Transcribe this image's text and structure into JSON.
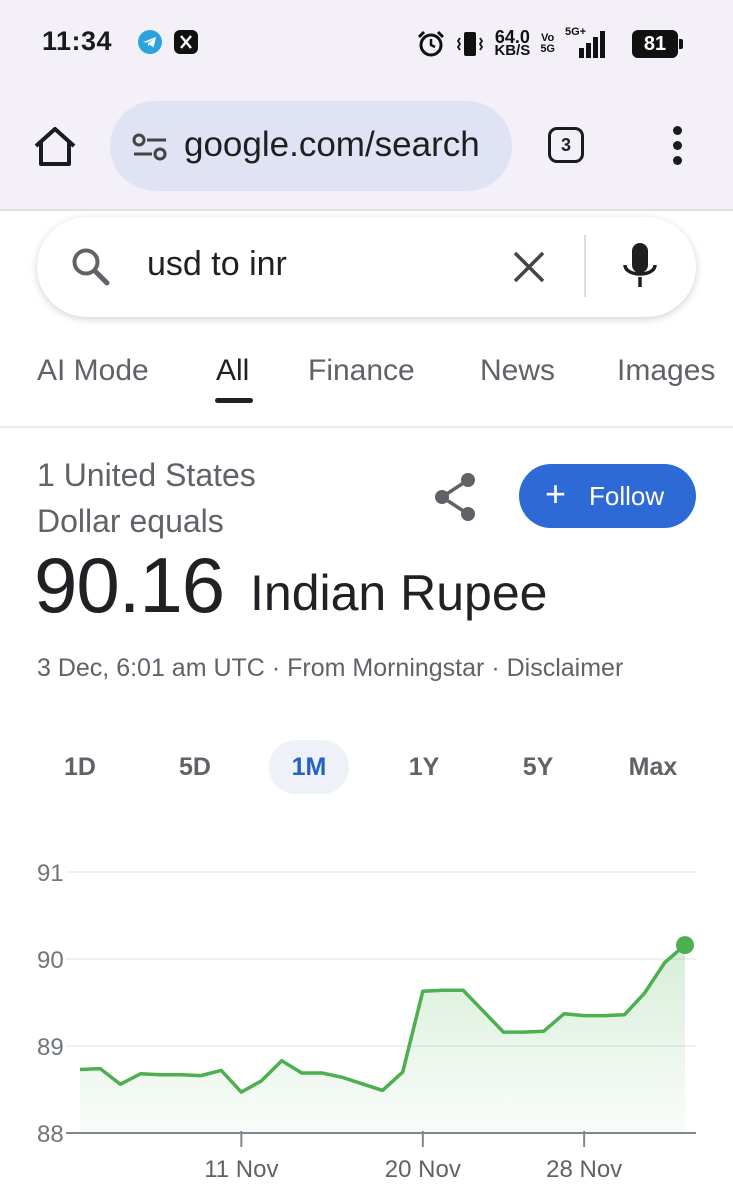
{
  "status_bar": {
    "time": "11:34",
    "notification_icons": [
      "telegram-icon",
      "x-icon"
    ],
    "network_speed_value": "64.0",
    "network_speed_unit": "KB/S",
    "volte_top": "Vo",
    "volte_bottom": "5G",
    "signal_label": "5G+",
    "battery": "81"
  },
  "browser": {
    "url": "google.com/search",
    "tab_count": "3"
  },
  "search": {
    "query": "usd to inr"
  },
  "tabs": [
    {
      "label": "AI Mode",
      "active": false
    },
    {
      "label": "All",
      "active": true
    },
    {
      "label": "Finance",
      "active": false
    },
    {
      "label": "News",
      "active": false
    },
    {
      "label": "Images",
      "active": false
    }
  ],
  "converter": {
    "equals_label": "1 United States Dollar equals",
    "rate": "90.16",
    "currency": "Indian Rupee",
    "timestamp": "3 Dec, 6:01 am UTC",
    "separator": "·",
    "source": "From Morningstar",
    "disclaimer": "Disclaimer",
    "follow_label": "Follow"
  },
  "ranges": [
    {
      "label": "1D",
      "active": false
    },
    {
      "label": "5D",
      "active": false
    },
    {
      "label": "1M",
      "active": true
    },
    {
      "label": "1Y",
      "active": false
    },
    {
      "label": "5Y",
      "active": false
    },
    {
      "label": "Max",
      "active": false
    }
  ],
  "colors": {
    "line": "#4caf50",
    "accent": "#2e6ad6"
  },
  "chart_data": {
    "type": "line",
    "title": "",
    "xlabel": "",
    "ylabel": "",
    "ylim": [
      88,
      91
    ],
    "yticks": [
      88,
      89,
      90,
      91
    ],
    "xlim": [
      "2025-11-03",
      "2025-12-03"
    ],
    "xticks": [
      {
        "date": "2025-11-11",
        "label": "11 Nov"
      },
      {
        "date": "2025-11-20",
        "label": "20 Nov"
      },
      {
        "date": "2025-11-28",
        "label": "28 Nov"
      }
    ],
    "grid": true,
    "series": [
      {
        "values": [
          {
            "x": "2025-11-03",
            "y": 88.73
          },
          {
            "x": "2025-11-04",
            "y": 88.74
          },
          {
            "x": "2025-11-05",
            "y": 88.56
          },
          {
            "x": "2025-11-06",
            "y": 88.68
          },
          {
            "x": "2025-11-07",
            "y": 88.67
          },
          {
            "x": "2025-11-08",
            "y": 88.67
          },
          {
            "x": "2025-11-09",
            "y": 88.66
          },
          {
            "x": "2025-11-10",
            "y": 88.72
          },
          {
            "x": "2025-11-11",
            "y": 88.47
          },
          {
            "x": "2025-11-12",
            "y": 88.6
          },
          {
            "x": "2025-11-13",
            "y": 88.83
          },
          {
            "x": "2025-11-14",
            "y": 88.69
          },
          {
            "x": "2025-11-15",
            "y": 88.69
          },
          {
            "x": "2025-11-16",
            "y": 88.64
          },
          {
            "x": "2025-11-18",
            "y": 88.49
          },
          {
            "x": "2025-11-19",
            "y": 88.7
          },
          {
            "x": "2025-11-20",
            "y": 89.63
          },
          {
            "x": "2025-11-21",
            "y": 89.64
          },
          {
            "x": "2025-11-22",
            "y": 89.64
          },
          {
            "x": "2025-11-24",
            "y": 89.16
          },
          {
            "x": "2025-11-25",
            "y": 89.16
          },
          {
            "x": "2025-11-26",
            "y": 89.17
          },
          {
            "x": "2025-11-27",
            "y": 89.37
          },
          {
            "x": "2025-11-28",
            "y": 89.35
          },
          {
            "x": "2025-11-29",
            "y": 89.35
          },
          {
            "x": "2025-11-30",
            "y": 89.36
          },
          {
            "x": "2025-12-01",
            "y": 89.61
          },
          {
            "x": "2025-12-02",
            "y": 89.96
          },
          {
            "x": "2025-12-03",
            "y": 90.16
          }
        ]
      }
    ]
  }
}
